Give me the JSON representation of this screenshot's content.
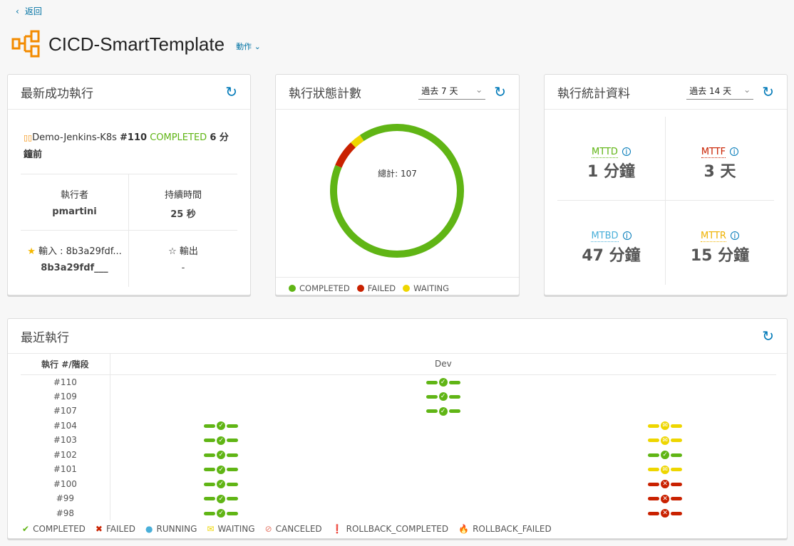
{
  "nav": {
    "back": "返回"
  },
  "header": {
    "title": "CICD-SmartTemplate",
    "actions": "動作"
  },
  "latest": {
    "title": "最新成功執行",
    "pipeline": "Demo-Jenkins-K8s",
    "run": "#110",
    "status": "COMPLETED",
    "ago": "6 分鐘前",
    "executor_label": "執行者",
    "executor": "pmartini",
    "duration_label": "持續時間",
    "duration": "25 秒",
    "input_label": "輸入 : 8b3a29fdf...",
    "input": "8b3a29fdf___",
    "output_label": "輸出",
    "output": "-"
  },
  "status_count": {
    "title": "執行狀態計數",
    "range": "過去 7 天",
    "total_label": "總計: 107",
    "chart_data": {
      "type": "pie",
      "donut": true,
      "categories": [
        "COMPLETED",
        "FAILED",
        "WAITING"
      ],
      "values": [
        97,
        7,
        3
      ],
      "colors": [
        "#60b515",
        "#c92100",
        "#eed600"
      ]
    },
    "legend": [
      "COMPLETED",
      "FAILED",
      "WAITING"
    ]
  },
  "stats": {
    "title": "執行統計資料",
    "range": "過去 14 天",
    "items": [
      {
        "label": "MTTD",
        "value": "1 分鐘",
        "color": "#60b515"
      },
      {
        "label": "MTTF",
        "value": "3 天",
        "color": "#c92100"
      },
      {
        "label": "MTBD",
        "value": "47 分鐘",
        "color": "#49afd9"
      },
      {
        "label": "MTTR",
        "value": "15 分鐘",
        "color": "#efb200"
      }
    ]
  },
  "recent": {
    "title": "最近執行",
    "col_header": "執行 #/階段",
    "stage": "Dev",
    "rows": [
      {
        "run": "#110",
        "cells": [
          null,
          "COMPLETED",
          null
        ]
      },
      {
        "run": "#109",
        "cells": [
          null,
          "COMPLETED",
          null
        ]
      },
      {
        "run": "#107",
        "cells": [
          null,
          "COMPLETED",
          null
        ]
      },
      {
        "run": "#104",
        "cells": [
          "COMPLETED",
          null,
          "WAITING"
        ]
      },
      {
        "run": "#103",
        "cells": [
          "COMPLETED",
          null,
          "WAITING"
        ]
      },
      {
        "run": "#102",
        "cells": [
          "COMPLETED",
          null,
          "COMPLETED"
        ]
      },
      {
        "run": "#101",
        "cells": [
          "COMPLETED",
          null,
          "WAITING"
        ]
      },
      {
        "run": "#100",
        "cells": [
          "COMPLETED",
          null,
          "FAILED"
        ]
      },
      {
        "run": "#99",
        "cells": [
          "COMPLETED",
          null,
          "FAILED"
        ]
      },
      {
        "run": "#98",
        "cells": [
          "COMPLETED",
          null,
          "FAILED"
        ]
      }
    ],
    "legend": [
      {
        "label": "COMPLETED",
        "icon": "check-circle",
        "color": "#60b515"
      },
      {
        "label": "FAILED",
        "icon": "x-circle",
        "color": "#c92100"
      },
      {
        "label": "RUNNING",
        "icon": "dot",
        "color": "#49afd9"
      },
      {
        "label": "WAITING",
        "icon": "envelope",
        "color": "#eed600"
      },
      {
        "label": "CANCELED",
        "icon": "ban",
        "color": "#e57b6c"
      },
      {
        "label": "ROLLBACK_COMPLETED",
        "icon": "exclamation-circle",
        "color": "#c92100"
      },
      {
        "label": "ROLLBACK_FAILED",
        "icon": "flame",
        "color": "#c92100"
      }
    ]
  }
}
